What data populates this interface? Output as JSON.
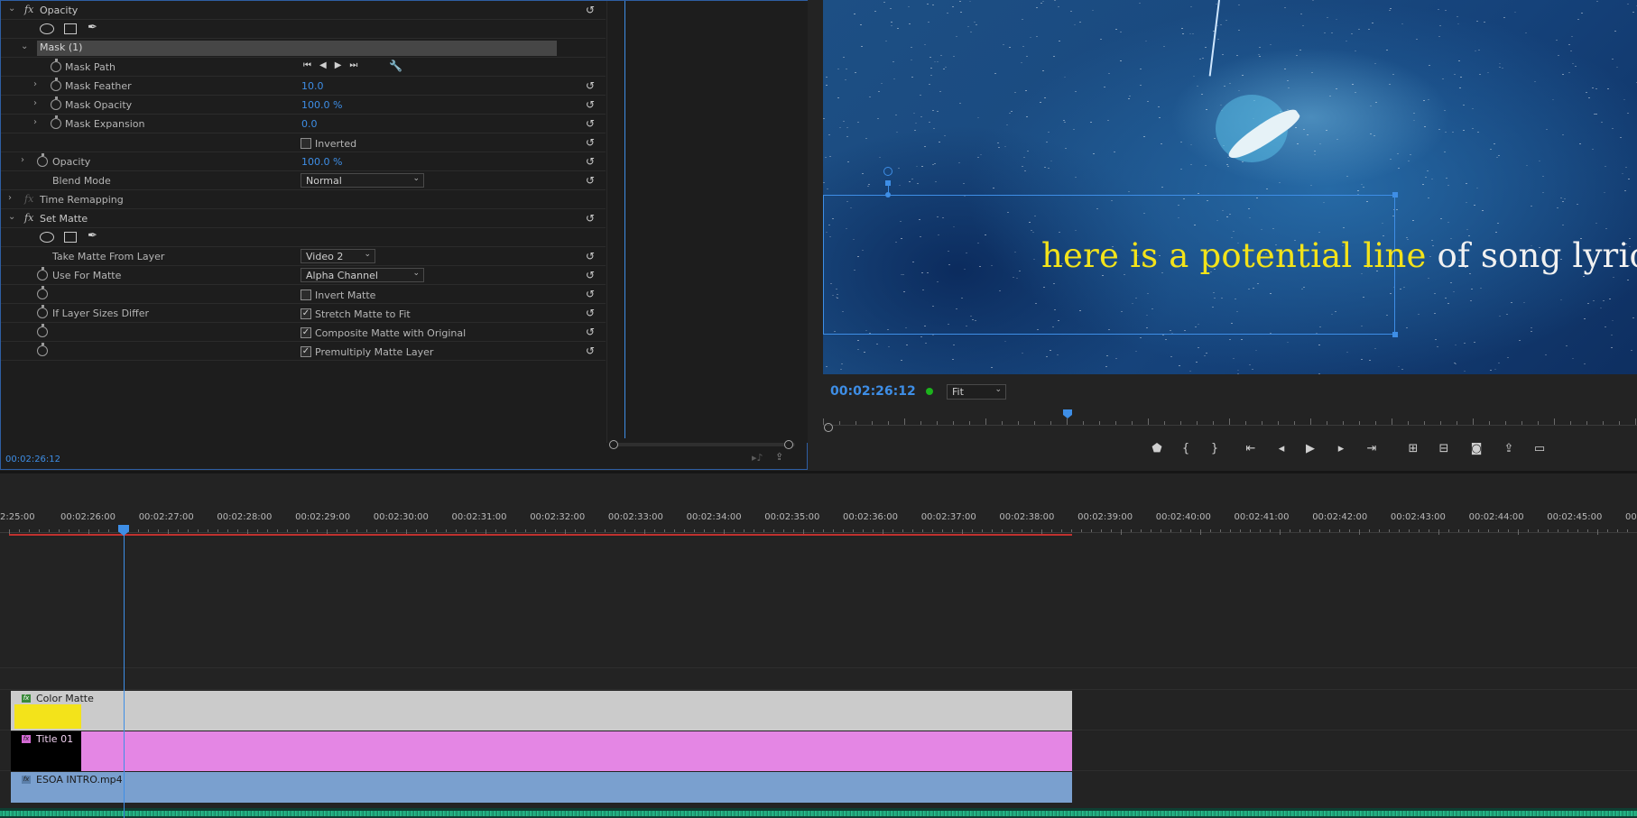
{
  "effect_controls": {
    "opacity_section": "Opacity",
    "mask_name": "Mask (1)",
    "mask_path": "Mask Path",
    "mask_feather": {
      "label": "Mask Feather",
      "value": "10.0"
    },
    "mask_opacity": {
      "label": "Mask Opacity",
      "value": "100.0 %"
    },
    "mask_expansion": {
      "label": "Mask Expansion",
      "value": "0.0"
    },
    "inverted": "Inverted",
    "opacity": {
      "label": "Opacity",
      "value": "100.0 %"
    },
    "blend_mode": {
      "label": "Blend Mode",
      "value": "Normal"
    },
    "time_remapping": "Time Remapping",
    "set_matte": "Set Matte",
    "take_matte": {
      "label": "Take Matte From Layer",
      "value": "Video 2"
    },
    "use_for_matte": {
      "label": "Use For Matte",
      "value": "Alpha Channel"
    },
    "invert_matte": "Invert Matte",
    "if_layer_sizes": "If Layer Sizes Differ",
    "stretch_matte": "Stretch Matte to Fit",
    "composite_matte": "Composite Matte with Original",
    "premultiply": "Premultiply Matte Layer",
    "timecode": "00:02:26:12"
  },
  "program_monitor": {
    "lyric_highlight": "here is a potential line",
    "lyric_rest": " of song lyrics",
    "timecode": "00:02:26:12",
    "fit": "Fit"
  },
  "timeline": {
    "ruler": [
      "2:25:00",
      "00:02:26:00",
      "00:02:27:00",
      "00:02:28:00",
      "00:02:29:00",
      "00:02:30:00",
      "00:02:31:00",
      "00:02:32:00",
      "00:02:33:00",
      "00:02:34:00",
      "00:02:35:00",
      "00:02:36:00",
      "00:02:37:00",
      "00:02:38:00",
      "00:02:39:00",
      "00:02:40:00",
      "00:02:41:00",
      "00:02:42:00",
      "00:02:43:00",
      "00:02:44:00",
      "00:02:45:00",
      "00"
    ],
    "clips": {
      "color_matte": "Color Matte",
      "title": "Title 01",
      "video": "ESOA INTRO.mp4"
    }
  },
  "colors": {
    "accent": "#3e8ee6",
    "color_matte": "#cbcbcb",
    "title": "#e486e4",
    "video": "#7aa0cf",
    "audio": "#1fa57a",
    "yellow": "#f3e31a"
  }
}
